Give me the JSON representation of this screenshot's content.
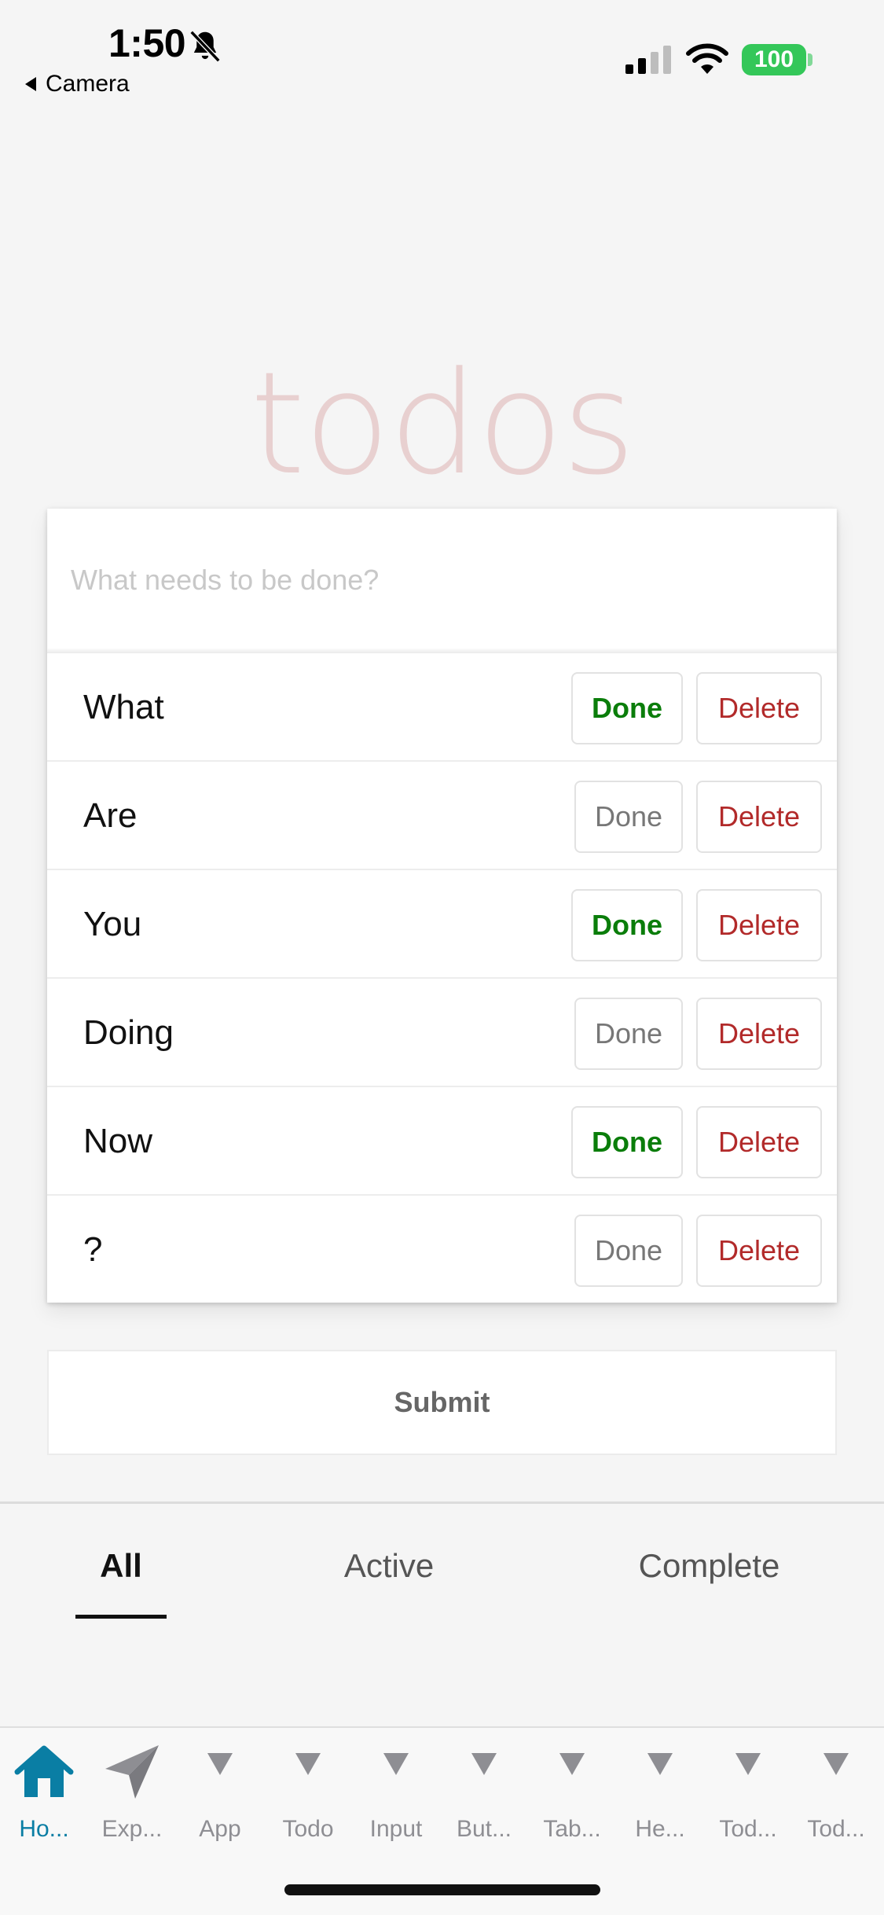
{
  "status_bar": {
    "time": "1:50",
    "back_label": "Camera",
    "battery": "100",
    "battery_color": "#34c759",
    "icons": [
      "bell-slash-icon",
      "signal-icon",
      "wifi-icon",
      "battery-icon"
    ]
  },
  "app": {
    "title": "todos",
    "title_color": "#af2f2f",
    "new_todo_placeholder": "What needs to be done?"
  },
  "todos": [
    {
      "label": "What",
      "done": true,
      "done_label": "Done",
      "delete_label": "Delete"
    },
    {
      "label": "Are",
      "done": false,
      "done_label": "Done",
      "delete_label": "Delete"
    },
    {
      "label": "You",
      "done": true,
      "done_label": "Done",
      "delete_label": "Delete"
    },
    {
      "label": "Doing",
      "done": false,
      "done_label": "Done",
      "delete_label": "Delete"
    },
    {
      "label": "Now",
      "done": true,
      "done_label": "Done",
      "delete_label": "Delete"
    },
    {
      "label": "?",
      "done": false,
      "done_label": "Done",
      "delete_label": "Delete"
    }
  ],
  "colors": {
    "done_active": "#0a7d0a",
    "done_inactive": "#777777",
    "delete": "#b22a2a",
    "tab_active": "#0a7ea4"
  },
  "submit_label": "Submit",
  "filters": {
    "all": "All",
    "active": "Active",
    "complete": "Complete",
    "selected": "All"
  },
  "tabbar": {
    "items": [
      {
        "label": "Ho...",
        "icon": "home-icon",
        "active": true
      },
      {
        "label": "Exp...",
        "icon": "paper-plane-icon",
        "active": false
      },
      {
        "label": "App",
        "icon": "triangle-down-icon",
        "active": false
      },
      {
        "label": "Todo",
        "icon": "triangle-down-icon",
        "active": false
      },
      {
        "label": "Input",
        "icon": "triangle-down-icon",
        "active": false
      },
      {
        "label": "But...",
        "icon": "triangle-down-icon",
        "active": false
      },
      {
        "label": "Tab...",
        "icon": "triangle-down-icon",
        "active": false
      },
      {
        "label": "He...",
        "icon": "triangle-down-icon",
        "active": false
      },
      {
        "label": "Tod...",
        "icon": "triangle-down-icon",
        "active": false
      },
      {
        "label": "Tod...",
        "icon": "triangle-down-icon",
        "active": false
      }
    ]
  }
}
